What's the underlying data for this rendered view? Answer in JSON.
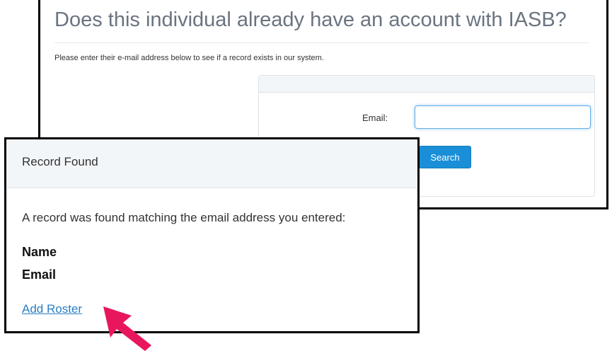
{
  "search_screen": {
    "title": "Does this individual already have an account with IASB?",
    "instruction": "Please enter their e-mail address below to see if a record exists in our system.",
    "email_label": "Email:",
    "email_value": "",
    "search_button_label": "Search"
  },
  "record_dialog": {
    "title": "Record Found",
    "message": "A record was found matching the email address you entered:",
    "name_label": "Name",
    "email_label": "Email",
    "add_roster_link": "Add Roster"
  },
  "colors": {
    "arrow": "#e8175d",
    "button": "#1a8fd8",
    "link": "#2a7ec4"
  },
  "icons": {
    "annotation": "arrow-pointer-icon"
  }
}
